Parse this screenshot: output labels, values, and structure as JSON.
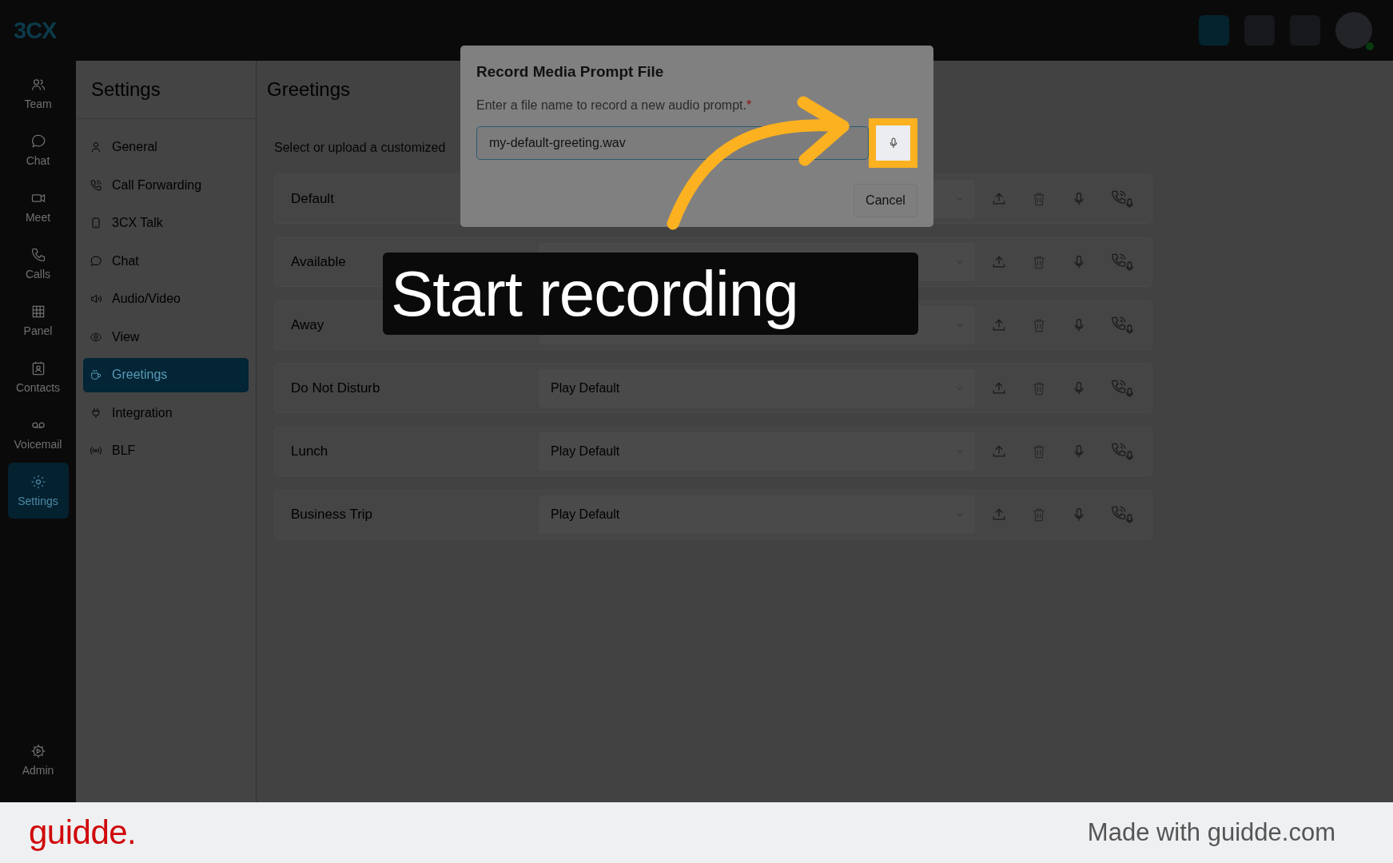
{
  "app": {
    "logo": "3CX"
  },
  "nav": [
    {
      "label": "Team",
      "kind": "team",
      "selected": false
    },
    {
      "label": "Chat",
      "kind": "chat",
      "selected": false
    },
    {
      "label": "Meet",
      "kind": "meet",
      "selected": false
    },
    {
      "label": "Calls",
      "kind": "calls",
      "selected": false
    },
    {
      "label": "Panel",
      "kind": "panel",
      "selected": false
    },
    {
      "label": "Contacts",
      "kind": "contacts",
      "selected": false
    },
    {
      "label": "Voicemail",
      "kind": "voicemail",
      "selected": false
    },
    {
      "label": "Settings",
      "kind": "settings",
      "selected": true
    }
  ],
  "nav_bottom": {
    "label": "Admin"
  },
  "settings": {
    "title": "Settings",
    "items": [
      {
        "label": "General",
        "kind": "person",
        "selected": false
      },
      {
        "label": "Call Forwarding",
        "kind": "phone",
        "selected": false
      },
      {
        "label": "3CX Talk",
        "kind": "mobile",
        "selected": false
      },
      {
        "label": "Chat",
        "kind": "chat",
        "selected": false
      },
      {
        "label": "Audio/Video",
        "kind": "speaker",
        "selected": false
      },
      {
        "label": "View",
        "kind": "eye",
        "selected": false
      },
      {
        "label": "Greetings",
        "kind": "cup",
        "selected": true
      },
      {
        "label": "Integration",
        "kind": "plug",
        "selected": false
      },
      {
        "label": "BLF",
        "kind": "signal",
        "selected": false
      }
    ]
  },
  "page": {
    "title": "Greetings",
    "subtitle": "Select or upload a customized",
    "rows": [
      {
        "label": "Default"
      },
      {
        "label": "Available"
      },
      {
        "label": "Away"
      },
      {
        "label": "Do Not Disturb",
        "value": "Play Default"
      },
      {
        "label": "Lunch",
        "value": "Play Default"
      },
      {
        "label": "Business Trip",
        "value": "Play Default"
      }
    ]
  },
  "dialog": {
    "title": "Record Media Prompt File",
    "label": "Enter a file name to record a new audio prompt.",
    "required_mark": "*",
    "value": "my-default-greeting.wav",
    "cancel": "Cancel"
  },
  "caption": "Start recording",
  "footer": {
    "logo": "guidde.",
    "text": "Made with guidde.com"
  }
}
